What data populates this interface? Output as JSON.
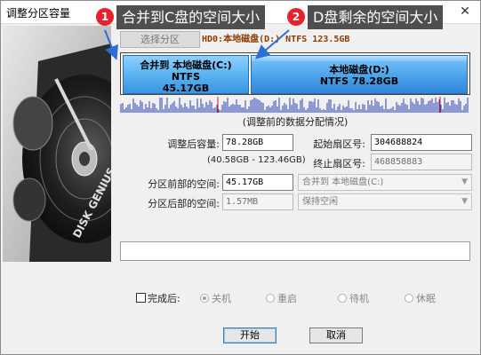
{
  "window": {
    "title": "调整分区容量",
    "close_glyph": "✕"
  },
  "art": {
    "logo_text": "DISK GENIUS"
  },
  "chooser": {
    "select_label": "选择分区",
    "disk_info": "HD0:本地磁盘(D:) NTFS 123.5GB"
  },
  "partitions": [
    {
      "name": "合并到 本地磁盘(C:)",
      "fs": "NTFS",
      "size": "45.17GB"
    },
    {
      "name": "本地磁盘(D:)",
      "fs": "NTFS 78.28GB"
    }
  ],
  "caption": "(调整前的数据分配情况)",
  "form": {
    "size_after_label": "调整后容量:",
    "size_after_value": "78.28GB",
    "range_hint": "(40.58GB - 123.46GB)",
    "start_sector_label": "起始扇区号:",
    "start_sector_value": "304688824",
    "end_sector_label": "终止扇区号:",
    "end_sector_value": "468858883",
    "space_before_label": "分区前部的空间:",
    "space_before_value": "45.17GB",
    "space_before_action": "合并到 本地磁盘(C:)",
    "space_after_label": "分区后部的空间:",
    "space_after_value": "1.57MB",
    "space_after_action": "保持空闲"
  },
  "completion": {
    "label": "完成后:",
    "options": [
      "关机",
      "重启",
      "待机",
      "休眠"
    ],
    "selected": "关机"
  },
  "buttons": {
    "start": "开始",
    "cancel": "取消"
  },
  "annotations": [
    {
      "number": "1",
      "text": "合并到C盘的空间大小"
    },
    {
      "number": "2",
      "text": "D盘剩余的空间大小"
    }
  ],
  "colors": {
    "partition_fill": "#4aa3ea",
    "callout_bg": "#4f4f4f",
    "badge": "#e5232e",
    "arrow": "#2b6fd6"
  }
}
